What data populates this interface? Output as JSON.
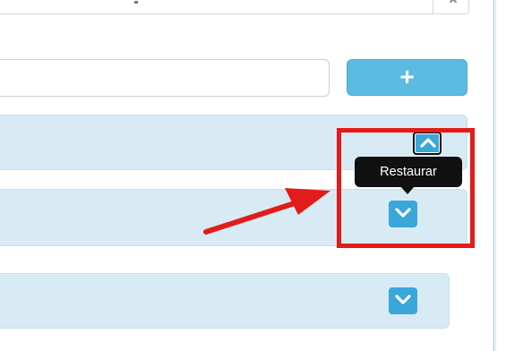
{
  "header": {
    "select_value": ""
  },
  "form": {
    "input_value": "",
    "add_button_label": "+"
  },
  "panels": [
    {
      "control": "chevron-up-icon",
      "state": "focused"
    },
    {
      "control": "chevron-down-icon",
      "state": "default"
    },
    {
      "control": "chevron-down-icon",
      "state": "default"
    }
  ],
  "tooltip": {
    "text": "Restaurar"
  },
  "colors": {
    "accent": "#3aa7db",
    "add_button": "#5bbbe0",
    "panel_bg": "#d8ebf5",
    "highlight": "#e21b1b",
    "tooltip_bg": "#111111"
  }
}
